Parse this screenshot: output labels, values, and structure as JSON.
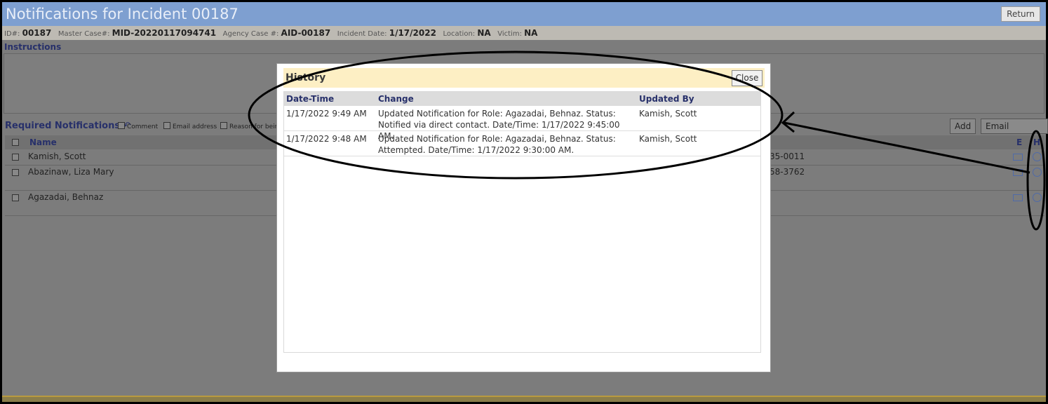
{
  "page": {
    "title": "Notifications for Incident 00187",
    "return_label": "Return"
  },
  "info": {
    "id_label": "ID#:",
    "id_value": "00187",
    "master_label": "Master Case#:",
    "master_value": "MID-20220117094741",
    "agency_label": "Agency Case #:",
    "agency_value": "AID-00187",
    "date_label": "Incident Date:",
    "date_value": "1/17/2022",
    "location_label": "Location:",
    "location_value": "NA",
    "victim_label": "Victim:",
    "victim_value": "NA"
  },
  "instructions_title": "Instructions",
  "required": {
    "title": "Required Notifications",
    "options": [
      "Comment",
      "Email address",
      "Reason for bein"
    ],
    "add_label": "Add",
    "email_selected_label": "Email Selected",
    "name_header": "Name",
    "e_header": "E",
    "h_header": "H",
    "rows": [
      {
        "name": "Kamish, Scott",
        "phone": "35-0011"
      },
      {
        "name": "Abazinaw, Liza Mary",
        "phone": "58-3762"
      },
      {
        "name": "Agazadai, Behnaz",
        "phone": ""
      }
    ]
  },
  "modal": {
    "title": "History",
    "close_label": "Close",
    "headers": {
      "datetime": "Date-Time",
      "change": "Change",
      "updated_by": "Updated By"
    },
    "rows": [
      {
        "datetime": "1/17/2022 9:49 AM",
        "change": "Updated Notification for Role: Agazadai, Behnaz. Status: Notified via direct contact. Date/Time: 1/17/2022 9:45:00 AM.",
        "updated_by": "Kamish, Scott"
      },
      {
        "datetime": "1/17/2022 9:48 AM",
        "change": "Updated Notification for Role: Agazadai, Behnaz. Status: Attempted. Date/Time: 1/17/2022 9:30:00 AM.",
        "updated_by": "Kamish, Scott"
      }
    ]
  },
  "colors": {
    "titlebar": "#7e9fd0",
    "modal_header": "#fdefc4",
    "heading_text": "#27306a"
  }
}
